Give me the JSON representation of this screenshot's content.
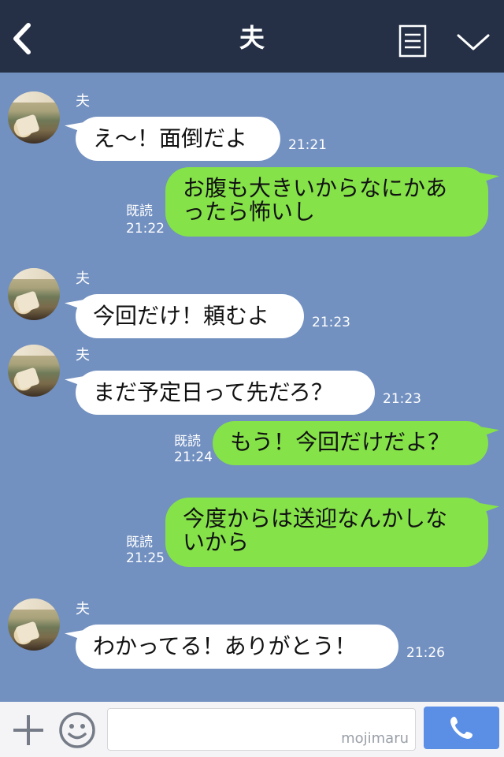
{
  "header": {
    "title": "夫",
    "back_icon": "chevron-left-icon",
    "menu_icon": "menu-list-icon",
    "expand_icon": "chevron-down-icon"
  },
  "messages": [
    {
      "side": "in",
      "sender": "夫",
      "text": "え〜！面倒だよ",
      "time": "21:21"
    },
    {
      "side": "out",
      "read": "既読",
      "lines": [
        "お腹も大きいからなにかあ",
        "ったら怖いし"
      ],
      "time": "21:22"
    },
    {
      "side": "in",
      "sender": "夫",
      "text": "今回だけ！頼むよ",
      "time": "21:23"
    },
    {
      "side": "in",
      "sender": "夫",
      "text": "まだ予定日って先だろ？",
      "time": "21:23"
    },
    {
      "side": "out",
      "read": "既読",
      "lines": [
        "もう！今回だけだよ？"
      ],
      "time": "21:24"
    },
    {
      "side": "out",
      "read": "既読",
      "lines": [
        "今度からは送迎なんかしな",
        "いから"
      ],
      "time": "21:25"
    },
    {
      "side": "in",
      "sender": "夫",
      "text": "わかってる！ありがとう！",
      "time": "21:26"
    }
  ],
  "input_bar": {
    "plus_icon": "plus-icon",
    "emoji_icon": "smiley-icon",
    "watermark": "mojimaru",
    "call_icon": "phone-icon"
  },
  "colors": {
    "header_bg": "#253047",
    "chat_bg": "#7290c0",
    "outgoing_bubble": "#85e249",
    "incoming_bubble": "#ffffff",
    "call_button": "#5b8fe6"
  }
}
